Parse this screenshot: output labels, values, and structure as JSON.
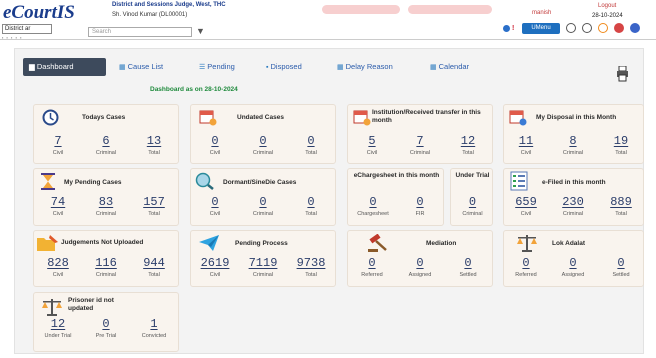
{
  "header": {
    "logo": "eCourtIS",
    "court_name": "District and Sessions Judge, West, THC",
    "judge": "Sh. Vinod Kumar (DL00001)",
    "search_placeholder": "Search",
    "district_select": "District ar",
    "user": "manish",
    "logout": "Logout",
    "date": "28-10-2024",
    "umenu": "UMenu"
  },
  "tabs": [
    {
      "label": "Dashboard",
      "active": true
    },
    {
      "label": "Cause List"
    },
    {
      "label": "Pending"
    },
    {
      "label": "Disposed"
    },
    {
      "label": "Delay Reason"
    },
    {
      "label": "Calendar"
    }
  ],
  "dashboard_as_on": "Dashboard as on 28-10-2024",
  "cards": {
    "todays_cases": {
      "title": "Todays Cases",
      "stats": [
        {
          "value": "7",
          "label": "Civil"
        },
        {
          "value": "6",
          "label": "Criminal"
        },
        {
          "value": "13",
          "label": "Total"
        }
      ]
    },
    "undated_cases": {
      "title": "Undated Cases",
      "stats": [
        {
          "value": "0",
          "label": "Civil"
        },
        {
          "value": "0",
          "label": "Criminal"
        },
        {
          "value": "0",
          "label": "Total"
        }
      ]
    },
    "institution": {
      "title": "Institution/Received transfer in this month",
      "stats": [
        {
          "value": "5",
          "label": "Civil"
        },
        {
          "value": "7",
          "label": "Criminal"
        },
        {
          "value": "12",
          "label": "Total"
        }
      ]
    },
    "my_disposal": {
      "title": "My Disposal in this Month",
      "stats": [
        {
          "value": "11",
          "label": "Civil"
        },
        {
          "value": "8",
          "label": "Criminal"
        },
        {
          "value": "19",
          "label": "Total"
        }
      ]
    },
    "my_pending": {
      "title": "My Pending Cases",
      "stats": [
        {
          "value": "74",
          "label": "Civil"
        },
        {
          "value": "83",
          "label": "Criminal"
        },
        {
          "value": "157",
          "label": "Total"
        }
      ]
    },
    "dormant": {
      "title": "Dormant/SineDie Cases",
      "stats": [
        {
          "value": "0",
          "label": "Civil"
        },
        {
          "value": "0",
          "label": "Criminal"
        },
        {
          "value": "0",
          "label": "Total"
        }
      ]
    },
    "echargesheet": {
      "title": "eChargesheet in this month",
      "stats": [
        {
          "value": "0",
          "label": "Chargesheet"
        },
        {
          "value": "0",
          "label": "FIR"
        }
      ]
    },
    "under_trial": {
      "title": "Under Trial",
      "stats": [
        {
          "value": "0",
          "label": "Criminal"
        }
      ]
    },
    "efiled": {
      "title": "e-Filed in this month",
      "stats": [
        {
          "value": "659",
          "label": "Civil"
        },
        {
          "value": "230",
          "label": "Criminal"
        },
        {
          "value": "889",
          "label": "Total"
        }
      ]
    },
    "judgements": {
      "title": "Judgements Not Uploaded",
      "stats": [
        {
          "value": "828",
          "label": "Civil"
        },
        {
          "value": "116",
          "label": "Criminal"
        },
        {
          "value": "944",
          "label": "Total"
        }
      ]
    },
    "pending_process": {
      "title": "Pending Process",
      "stats": [
        {
          "value": "2619",
          "label": "Civil"
        },
        {
          "value": "7119",
          "label": "Criminal"
        },
        {
          "value": "9738",
          "label": "Total"
        }
      ]
    },
    "mediation": {
      "title": "Mediation",
      "stats": [
        {
          "value": "0",
          "label": "Referred"
        },
        {
          "value": "0",
          "label": "Assigned"
        },
        {
          "value": "0",
          "label": "Settled"
        }
      ]
    },
    "lok_adalat": {
      "title": "Lok Adalat",
      "stats": [
        {
          "value": "0",
          "label": "Referred"
        },
        {
          "value": "0",
          "label": "Assigned"
        },
        {
          "value": "0",
          "label": "Settled"
        }
      ]
    },
    "prisoner": {
      "title": "Prisoner id not updated",
      "stats": [
        {
          "value": "12",
          "label": "Under Trial"
        },
        {
          "value": "0",
          "label": "Pre Trial"
        },
        {
          "value": "1",
          "label": "Convicted"
        }
      ]
    }
  },
  "icons": {
    "clock": "clock-icon",
    "calendar": "calendar-icon",
    "hourglass": "hourglass-icon",
    "search": "magnifier-icon",
    "checklist": "checklist-icon",
    "folder": "folder-icon",
    "plane": "paper-plane-icon",
    "gavel": "gavel-icon",
    "scales": "scales-icon",
    "print": "print-icon"
  },
  "colors": {
    "accent": "#1a3c8c",
    "tab_active": "#3d4a5c",
    "green_text": "#1e8a3c",
    "card_bg": "#f9f4ee"
  }
}
